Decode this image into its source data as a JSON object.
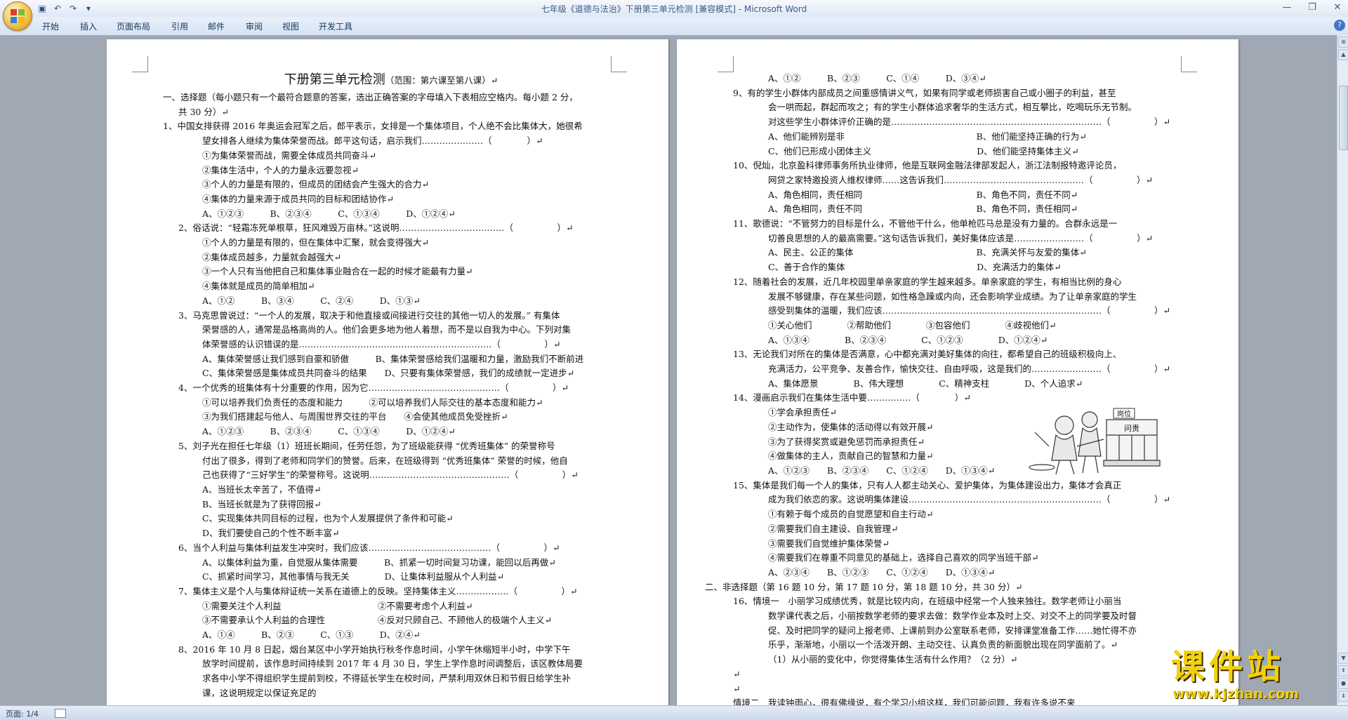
{
  "window": {
    "title": "七年级《道德与法治》下册第三单元检测 [兼容模式] - Microsoft Word",
    "controls": [
      "—",
      "❐",
      "✕"
    ]
  },
  "qat": {
    "save_icon": "save-icon",
    "undo_icon": "undo-icon",
    "redo_icon": "redo-icon",
    "customize_icon": "customize-qat-icon"
  },
  "ribbon": {
    "tabs": [
      "开始",
      "插入",
      "页面布局",
      "引用",
      "邮件",
      "审阅",
      "视图",
      "开发工具"
    ],
    "help": "?"
  },
  "page1": {
    "lines": [
      "下册第三单元检测",
      "（范围：第六课至第八课）↵",
      "一、选择题（每小题只有一个最符合题意的答案，选出正确答案的字母填入下表相应空格内。每小题 2 分，",
      "共 30 分）↵",
      "1、中国女排获得 2016 年奥运会冠军之后，郎平表示，女排是一个集体项目，个人绝不会比集体大，她很希",
      "望女排各人继续为集体荣誉而战。郎平这句话，启示我们…………………（　　　　）↵",
      "①为集体荣誉而战，需要全体成员共同奋斗↵",
      "②集体生活中，个人的力量永远要忽视↵",
      "③个人的力量是有限的，但成员的团结会产生强大的合力↵",
      "④集体的力量来源于成员共同的目标和团结协作↵",
      "A、①②③　　　B、②③④　　　C、①③④　　　D、①②④↵",
      "2、俗话说：“轻霜冻死单根草，狂风难毁万亩林。”这说明………………………………（　　　　　）↵",
      "①个人的力量是有限的，但在集体中汇聚，就会变得强大↵",
      "②集体成员越多，力量就会越强大↵",
      "③一个人只有当他把自己和集体事业融合在一起的时候才能最有力量↵",
      "④集体就是成员的简单相加↵",
      "A、①②　　　B、③④　　　C、②④　　　D、①③↵",
      "3、马克思曾说过：“一个人的发展，取决于和他直接或间接进行交往的其他一切人的发展。” 有集体",
      "荣誉感的人，通常是品格高尚的人。他们会更多地为他人着想，而不是以自我为中心。下列对集",
      "体荣誉感的认识错误的是…………………………………………………………（　　　　　）↵",
      "A、集体荣誉感让我们感到自豪和骄傲　　　B、集体荣誉感给我们温暖和力量，激励我们不断前进",
      "C、集体荣誉感是集体成员共同奋斗的结果　　D、只要有集体荣誉感，我们的成绩就一定进步↵",
      "4、一个优秀的班集体有十分重要的作用，因为它………………………………………（　　　　　）↵",
      "①可以培养我们负责任的态度和能力　　　②可以培养我们人际交往的基本态度和能力↵",
      "③为我们搭建起与他人、与周围世界交往的平台　　④会使其他成员免受挫折↵",
      "A、①②③　　　B、②③④　　　C、①③④　　　D、①②④↵",
      "5、刘子光在担任七年级（1）班班长期间，任劳任怨，为了班级能获得 “优秀班集体” 的荣誉称号",
      "付出了很多，得到了老师和同学们的赞誉。后来，在班级得到 “优秀班集体” 荣誉的时候，他自",
      "己也获得了“三好学生”的荣誉称号。这说明…………………………………………（　　　　　）↵",
      "A、当班长太辛苦了，不值得↵",
      "B、当班长就是为了获得回报↵",
      "C、实现集体共同目标的过程，也为个人发展提供了条件和可能↵",
      "D、我们要使自己的个性不断丰富↵",
      "6、当个人利益与集体利益发生冲突时，我们应该……………………………………（　　　　　）↵",
      "A、以集体利益为重，自觉服从集体需要　　　B、抓紧一切时间复习功课，能回以后再做↵",
      "C、抓紧时间学习，其他事情与我无关　　　　D、让集体利益服从个人利益↵",
      "7、集体主义是个人与集体辩证统一关系在道德上的反映。坚持集体主义………………（　　　　　）↵",
      "①需要关注个人利益　　　　　　　　　　　②不需要考虑个人利益↵",
      "③不需要承认个人利益的合理性　　　　　　④反对只顾自己、不顾他人的极端个人主义↵",
      "A、①④　　　B、②③　　　C、①③　　　D、②④↵",
      "8、2016 年 10 月 8 日起，烟台某区中小学开始执行秋冬作息时间，小学午休缩短半小时，中学下午",
      "放学时间提前，该作息时间持续到 2017 年 4 月 30 日，学生上学作息时间调整后，该区教体局要",
      "求各中小学不得组织学生提前到校，不得延长学生在校时间，严禁利用双休日和节假日给学生补",
      "课，这说明规定以保证充足的"
    ]
  },
  "page2": {
    "lines": [
      "A、①②　　　B、②③　　　C、①④　　　D、③④↵",
      "9、有的学生小群体内部成员之间重感情讲义气，如果有同学或老师损害自己或小圈子的利益，甚至",
      "会一哄而起，群起而攻之；有的学生小群体追求奢华的生活方式，相互攀比，吃喝玩乐无节制。",
      "对这些学生小群体评价正确的是………………………………………………………………（　　　　　）↵",
      "A、他们能辨别是非　　　　　　　　　　　　　　　B、他们能坚持正确的行为↵",
      "C、他们已形成小团体主义　　　　　　　　　　　　D、他们能坚持集体主义↵",
      "10、倪灿，北京盈科律师事务所执业律师，他是互联网金融法律部发起人，浙江法制报特邀评论员，",
      "网贷之家特邀投资人维权律师……这告诉我们…………………………………………（　　　　　）↵",
      "A、角色相同，责任相同　　　　　　　　　　　　　B、角色不同，责任不同↵",
      "A、角色相同，责任不同　　　　　　　　　　　　　B、角色不同，责任相同↵",
      "11、歌德说：“不管努力的目标是什么，不管他干什么，他单枪匹马总是没有力量的。合群永远是一",
      "切善良思想的人的最高需要。”这句话告诉我们，美好集体应该是……………………（　　　　　）↵",
      "A、民主、公正的集体　　　　　　　　　　　　　　B、充满关怀与友爱的集体↵",
      "C、善于合作的集体　　　　　　　　　　　　　　　D、充满活力的集体↵",
      "12、随着社会的发展，近几年校园里单亲家庭的学生越来越多。单亲家庭的学生，有相当比例的身心",
      "发展不够健康，存在某些问题，如性格急躁或内向，还会影响学业成绩。为了让单亲家庭的学生",
      "感受到集体的温暖，我们应该…………………………………………………………………（　　　　　）↵",
      "①关心他们　　　　②帮助他们　　　　③包容他们　　　　④歧视他们↵",
      "A、①③④　　　　B、②③④　　　　C、①②③　　　　D、①②④↵",
      "13、无论我们对所在的集体是否满意，心中都充满对美好集体的向往，都希望自己的班级积极向上、",
      "充满活力，公平竞争、友善合作，愉快交往、自由呼吸，这是我们的……………………（　　　　　）↵",
      "A、集体愿景　　　　B、伟大理想　　　　C、精神支柱　　　　D、个人追求↵",
      "14、漫画启示我们在集体生活中要……………（　　　　）↵",
      "①学会承担责任↵",
      "②主动作为，使集体的活动得以有效开展↵",
      "③为了获得奖赏或避免惩罚而承担责任↵",
      "④做集体的主人，贡献自己的智慧和力量↵",
      "A、①②③　　B、②③④　　C、①②④　　D、①③④↵",
      "15、集体是我们每一个人的集体，只有人人都主动关心、爱护集体，为集体建设出力，集体才会真正",
      "成为我们依恋的家。这说明集体建设…………………………………………………………（　　　　　）↵",
      "①有赖于每个成员的自觉愿望和自主行动↵",
      "②需要我们自主建设、自我管理↵",
      "③需要我们自觉维护集体荣誉↵",
      "④需要我们在尊重不同意见的基础上，选择自己喜欢的同学当班干部↵",
      "A、②③④　　B、①②③　　C、①②④　　D、①③④↵",
      "二、非选择题（第 16 题 10 分，第 17 题 10 分，第 18 题 10 分，共 30 分）↵",
      "16、情境一　小丽学习成绩优秀，就是比较内向，在班级中经常一个人独来独往。数学老师让小丽当",
      "数学课代表之后，小丽按数学老师的要求去做：数学作业本及时上交、对交不上的同学要及时督",
      "促、及时把同学的疑问上报老师、上课前到办公室联系老师，安排课堂准备工作……她忙得不亦",
      "乐乎，渐渐地，小丽以一个活泼开朗、主动交往、认真负责的新面貌出现在同学面前了。↵",
      "（1）从小丽的变化中，你觉得集体生活有什么作用？（2 分）↵",
      "↵",
      "↵",
      "情境二　我读钟雨心，很有佛缘说，有个学习小组这样，我们可能问题，我有许多说不来"
    ]
  },
  "cartoon": {
    "sign_1": "岗位",
    "sign_2": "问责"
  },
  "status": {
    "page": "页面: 1/4"
  },
  "watermark": {
    "name": "课件站",
    "url": "www.kjzhan.com"
  }
}
